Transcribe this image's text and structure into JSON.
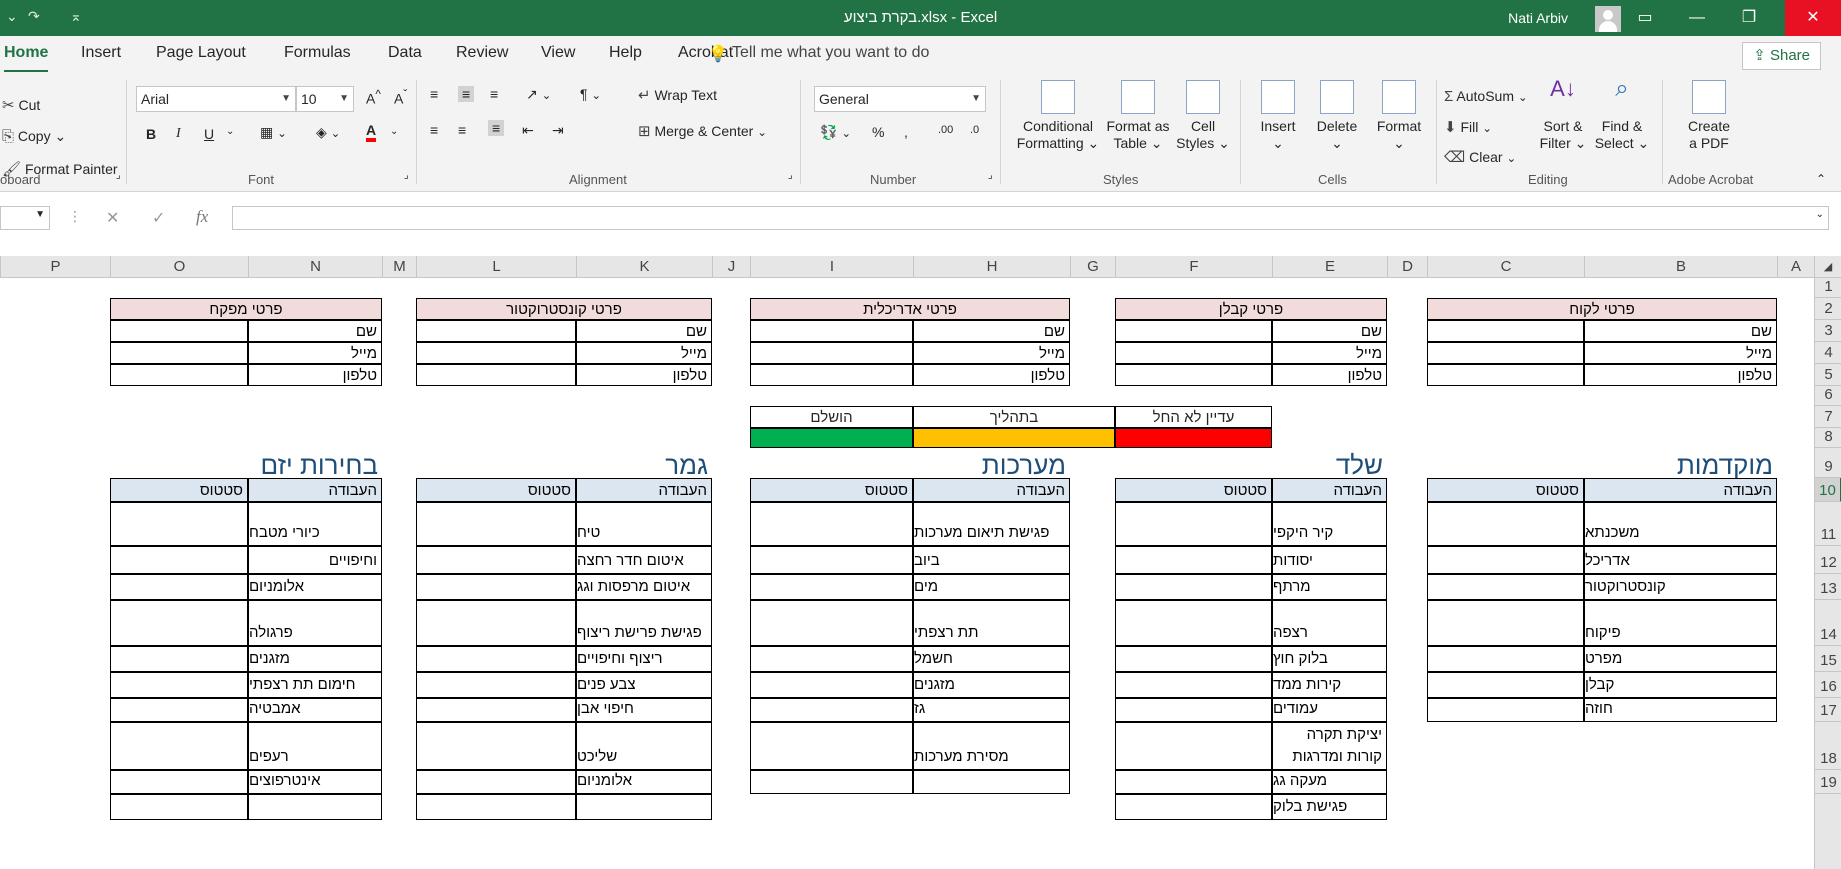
{
  "window": {
    "title": "בקרת ביצוע.xlsx  -  Excel",
    "user": "Nati Arbiv",
    "colors": {
      "accent": "#217346",
      "close": "#e81123"
    }
  },
  "menu": {
    "tabs": [
      "Home",
      "Insert",
      "Page Layout",
      "Formulas",
      "Data",
      "Review",
      "View",
      "Help",
      "Acrobat"
    ],
    "tell_me": "Tell me what you want to do",
    "share": "Share"
  },
  "ribbon": {
    "clipboard": {
      "cut": "Cut",
      "copy": "Copy",
      "format_painter": "Format Painter",
      "label": "oboard"
    },
    "font": {
      "name": "Arial",
      "size": "10",
      "label": "Font"
    },
    "alignment": {
      "wrap": "Wrap Text",
      "merge": "Merge & Center",
      "label": "Alignment"
    },
    "number": {
      "format": "General",
      "label": "Number"
    },
    "styles": {
      "conditional": [
        "Conditional",
        "Formatting"
      ],
      "format_table": [
        "Format as",
        "Table"
      ],
      "cell_styles": [
        "Cell",
        "Styles"
      ],
      "label": "Styles"
    },
    "cells": {
      "insert": "Insert",
      "delete": "Delete",
      "format": "Format",
      "label": "Cells"
    },
    "editing": {
      "autosum": "AutoSum",
      "fill": "Fill",
      "clear": "Clear",
      "sort": [
        "Sort &",
        "Filter"
      ],
      "find": [
        "Find &",
        "Select"
      ],
      "label": "Editing"
    },
    "acrobat": {
      "create": [
        "Create",
        "a PDF"
      ],
      "label": "Adobe Acrobat"
    }
  },
  "grid": {
    "columns": [
      "P",
      "O",
      "N",
      "M",
      "L",
      "K",
      "J",
      "I",
      "H",
      "G",
      "F",
      "E",
      "D",
      "C",
      "B",
      "A"
    ],
    "rows": [
      "1",
      "2",
      "3",
      "4",
      "5",
      "6",
      "7",
      "8",
      "9",
      "10",
      "11",
      "12",
      "13",
      "14",
      "15",
      "16",
      "17",
      "18",
      "19"
    ],
    "selected_row": "10"
  },
  "info_tables": [
    {
      "title": "פרטי לקוח",
      "rows": [
        "שם",
        "מייל",
        "טלפון"
      ]
    },
    {
      "title": "פרטי קבלן",
      "rows": [
        "שם",
        "מייל",
        "טלפון"
      ]
    },
    {
      "title": "פרטי אדריכלית",
      "rows": [
        "שם",
        "מייל",
        "טלפון"
      ]
    },
    {
      "title": "פרטי קונסטרוקטור",
      "rows": [
        "שם",
        "מייל",
        "טלפון"
      ]
    },
    {
      "title": "פרטי מפקח",
      "rows": [
        "שם",
        "מייל",
        "טלפון"
      ]
    }
  ],
  "legend": [
    {
      "label": "עדיין לא החל",
      "color": "#ff0000"
    },
    {
      "label": "בתהליך",
      "color": "#ffc000"
    },
    {
      "label": "הושלם",
      "color": "#00b050"
    }
  ],
  "sections": [
    {
      "title": "מוקדמות",
      "col_task": "העבודה",
      "col_status": "סטטוס",
      "tasks": [
        "משכנתא",
        "אדריכל",
        "קונסטרוקטור",
        "פיקוח",
        "מפרט",
        "קבלן",
        "חוזה"
      ]
    },
    {
      "title": "שלד",
      "col_task": "העבודה",
      "col_status": "סטטוס",
      "tasks": [
        "קיר היקפי",
        "יסודות",
        "מרתף",
        "רצפה",
        "בלוק חוץ",
        "קירות ממד",
        "עמודים",
        "יציקת תקרה קורות ומדרגות",
        "מעקה גג",
        "פגישת בלוק"
      ]
    },
    {
      "title": "מערכות",
      "col_task": "העבודה",
      "col_status": "סטטוס",
      "tasks": [
        "פגישת תיאום מערכות",
        "ביוב",
        "מים",
        "תת רצפתי",
        "חשמל",
        "מזגנים",
        "גז",
        "מסירת מערכות",
        ""
      ]
    },
    {
      "title": "גמר",
      "col_task": "העבודה",
      "col_status": "סטטוס",
      "tasks": [
        "טיח",
        "איטום חדר רחצה",
        "איטום מרפסות וגג",
        "פגישת פרישת ריצוף",
        "ריצוף וחיפויים",
        "צבע פנים",
        "חיפוי אבן",
        "שליכט",
        "אלומניום",
        ""
      ]
    },
    {
      "title": "בחירות יזם",
      "col_task": "העבודה",
      "col_status": "סטטוס",
      "tasks": [
        "כיורי מטבח",
        "בחירת ריצופים וחיפויים",
        "אלומניום",
        "פרגולה",
        "מזגנים",
        "חימום תת רצפתי",
        "אמבטיה",
        "רעפים",
        "אינטרפוצים",
        ""
      ]
    }
  ]
}
